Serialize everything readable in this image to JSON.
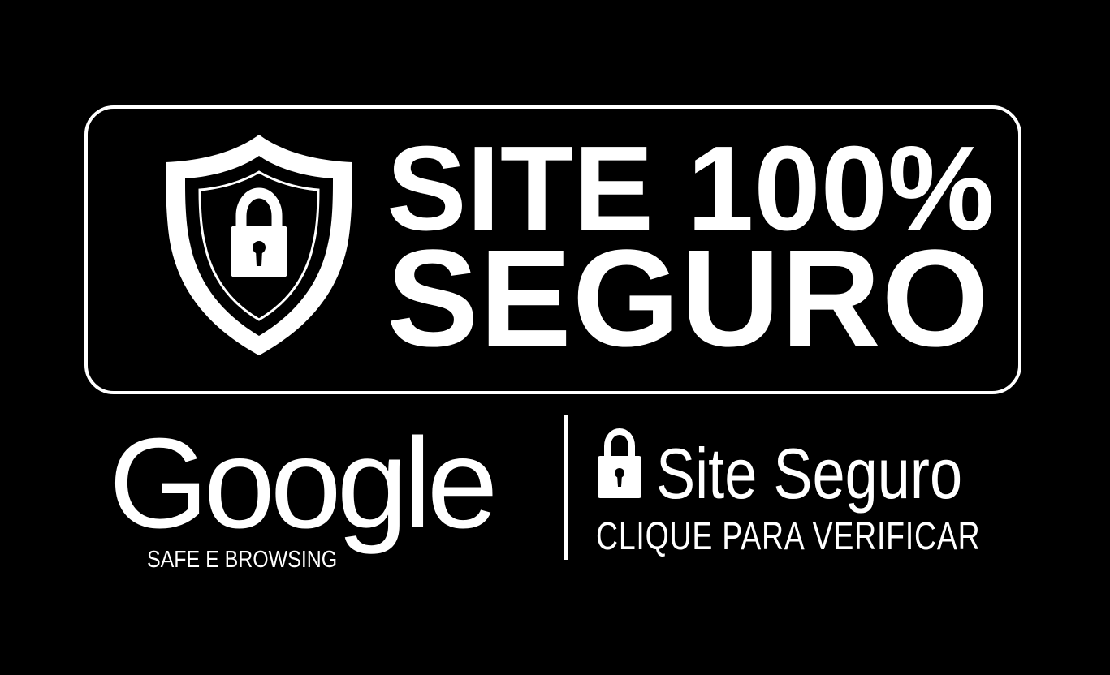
{
  "badge": {
    "headline_line1": "SITE 100%",
    "headline_line2": "SEGURO",
    "icon": "shield-lock-icon"
  },
  "google": {
    "wordmark": "Google",
    "subtitle": "SAFE E BROWSING"
  },
  "verify": {
    "icon": "padlock-icon",
    "title": "Site Seguro",
    "action": "CLIQUE PARA VERIFICAR"
  },
  "colors": {
    "background": "#000000",
    "foreground": "#ffffff"
  }
}
